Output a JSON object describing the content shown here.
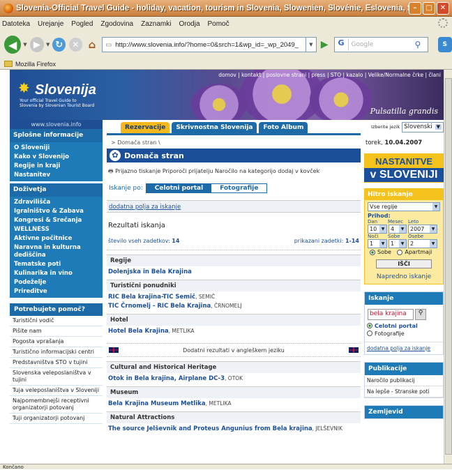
{
  "window": {
    "title": "Slovenia-Official Travel Guide - holiday, vacation, tourism in Slovenia, Slowenien, Slovénie, Eslovenia, Slovenija..."
  },
  "menu": [
    "Datoteka",
    "Urejanje",
    "Pogled",
    "Zgodovina",
    "Zaznamki",
    "Orodja",
    "Pomoč"
  ],
  "nav": {
    "url": "http://www.slovenia.info/?home=0&srch=1&wp_id=_wp_2049_",
    "search_placeholder": "Google",
    "search_engine_icon": "G"
  },
  "bookmarks": {
    "item": "Mozilla Firefox"
  },
  "status": "Končano",
  "banner": {
    "logo_name": "Slovenija",
    "logo_sub1": "Your official Travel Guide to",
    "logo_sub2": "Slovenia by Slovenian Tourist Board",
    "topnav": "domov | kontakt | poslovne strani | press | STO | kazalo | Velike/Normalne črke | člani",
    "caption": "Pulsatilla grandis"
  },
  "sidebar": {
    "url": "www.slovenia.info",
    "head1": "Splošne informacije",
    "group1": [
      "O Sloveniji",
      "Kako v Slovenijo",
      "Regije in kraji",
      "Nastanitev"
    ],
    "head2": "Doživetja",
    "group2": [
      "Zdravilišča",
      "Igralništvo & Zabava",
      "Kongresi & Srečanja",
      "WELLNESS",
      "Aktivne počitnice",
      "Naravna in kulturna dediščina",
      "Tematske poti",
      "Kulinarika in vino",
      "Podeželje",
      "Prireditve"
    ],
    "help_head": "Potrebujete pomoč?",
    "links": [
      "Turistični vodič",
      "Pišite nam",
      "Pogosta vprašanja",
      "Turistično informacijski centri",
      "Predstavništva STO v tujini",
      "Slovenska veleposlaništva v tujini",
      "Tuja veleposlaništva v Sloveniji",
      "Najpomembnejši receptivni organizatorji potovanj",
      "Tuji organizatorji potovanj"
    ]
  },
  "main": {
    "tabs": [
      "Rezervacije",
      "Skrivnostna Slovenija",
      "Foto Album"
    ],
    "breadcrumb": "> Domača stran \\",
    "page_title": "Domača stran",
    "tools": "Prijazno tiskanje   Priporoči prijatelju   Naročilo na kategorijo   dodaj v kovček",
    "search_by_label": "Iskanje po:",
    "search_by_on": "Celotni portal",
    "search_by_off": "Fotografije",
    "extra_fields": "dodatna polja za iskanje",
    "results_title": "Rezultati iskanja",
    "count_label": "število vseh zadetkov: ",
    "count_value": "14",
    "shown_label": "prikazani zadetki: ",
    "shown_value": "1-14",
    "sections": [
      {
        "title": "Regije",
        "items": [
          {
            "name": "Dolenjska in Bela Krajina",
            "place": ""
          }
        ]
      },
      {
        "title": "Turistični ponudniki",
        "items": [
          {
            "name": "RIC Bela krajina-TIC Semič",
            "place": ", SEMIČ"
          },
          {
            "name": "TIC Črnomelj - RIC Bela Krajina",
            "place": ", ČRNOMELJ"
          }
        ]
      },
      {
        "title": "Hotel",
        "items": [
          {
            "name": "Hotel Bela Krajina",
            "place": ", METLIKA"
          }
        ]
      }
    ],
    "en_results": "Dodatni rezultati v angleškem jeziku",
    "sections_en": [
      {
        "title": "Cultural and Historical Heritage",
        "items": [
          {
            "name": "Otok in Bela krajina, Airplane DC-3",
            "place": ", OTOK"
          }
        ]
      },
      {
        "title": "Museum",
        "items": [
          {
            "name": "Bela Krajina Museum Metlika",
            "place": ", METLIKA"
          }
        ]
      },
      {
        "title": "Natural Attractions",
        "items": [
          {
            "name": "The source Jelševnik and Proteus Angunius from Bela krajina",
            "place": ", JELŠEVNIK"
          }
        ]
      }
    ]
  },
  "right": {
    "lang_label": "Izberite jezik",
    "lang_value": "Slovenski",
    "date_day": "torek, ",
    "date_value": "10.04.2007",
    "nast_line1": "NASTANITVE",
    "nast_line2": "v SLOVENIJI",
    "hitro_head": "Hitro iskanje",
    "region_select": "Vse regije",
    "prihod_label": "Prihod:",
    "dan": "Dan",
    "mesec": "Mesec",
    "leto": "Leto",
    "dan_val": "10",
    "mesec_val": "4",
    "leto_val": "2007",
    "noci": "Noči",
    "sobe": "Sobe",
    "osebe": "Osebe",
    "noci_val": "1",
    "sobe_val": "1",
    "osebe_val": "2",
    "opt_sobe": "Sobe",
    "opt_apart": "Apartmaji",
    "isci": "IŠČI",
    "napredno": "Napredno iskanje",
    "iskanje_head": "Iskanje",
    "search_value": "bela krajina",
    "radio_portal": "Celotni portal",
    "radio_foto": "Fotografije",
    "extra_fields": "dodatna polja za iskanje",
    "pub_head": "Publikacije",
    "pub_items": [
      "Naročilo publikacij",
      "Na lepše - Stranske poti"
    ],
    "map_head": "Zemljevid"
  },
  "colors": {
    "brand_blue": "#1c6aa8",
    "accent_yellow": "#f4c21c",
    "link_blue": "#1c4f9a"
  }
}
